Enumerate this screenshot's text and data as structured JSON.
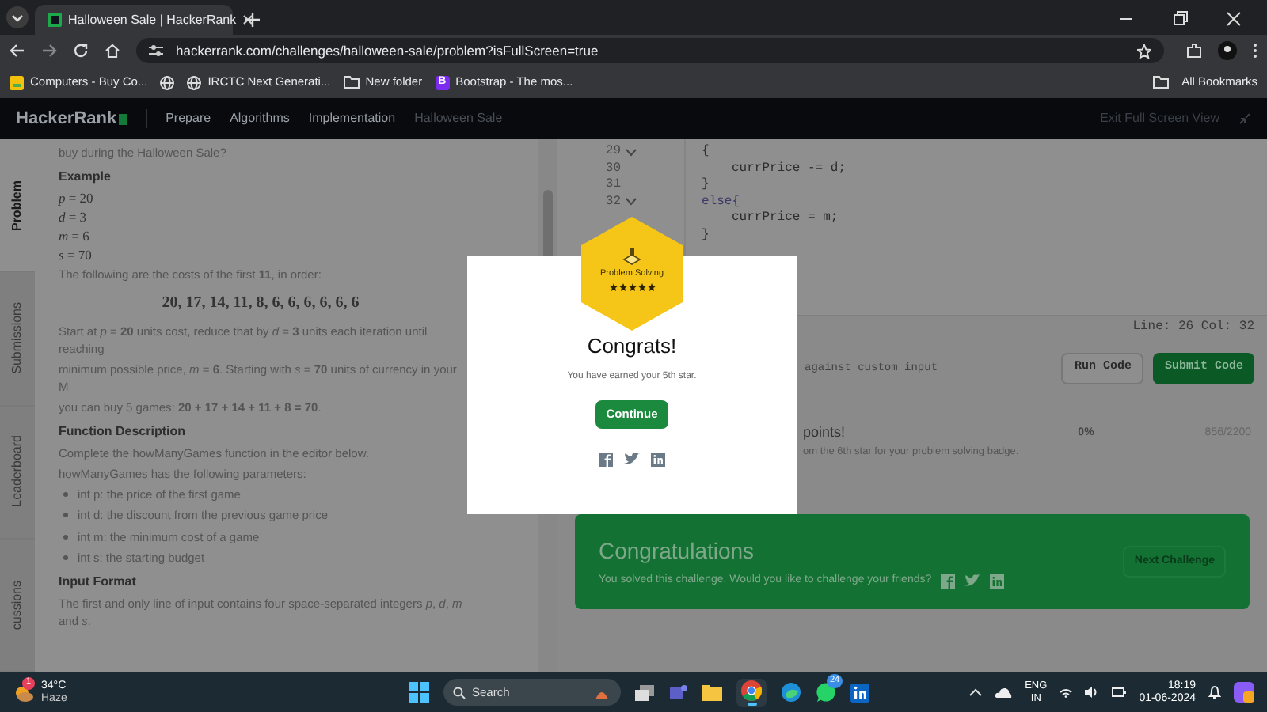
{
  "browser": {
    "tab_title": "Halloween Sale | HackerRank",
    "url": "hackerrank.com/challenges/halloween-sale/problem?isFullScreen=true",
    "bookmarks": [
      {
        "kind": "site",
        "label": "Computers - Buy Co..."
      },
      {
        "kind": "globe"
      },
      {
        "kind": "globe",
        "label": "IRCTC Next Generati..."
      },
      {
        "kind": "folder",
        "label": "New folder"
      },
      {
        "kind": "letter",
        "letter": "B",
        "label": "Bootstrap - The mos..."
      }
    ],
    "all_bookmarks": "All Bookmarks"
  },
  "nav": {
    "logo": "HackerRank",
    "items": [
      "Prepare",
      "Algorithms",
      "Implementation"
    ],
    "current": "Halloween Sale",
    "exit": "Exit Full Screen View"
  },
  "side_tabs": [
    {
      "label": "Problem",
      "selected": true
    },
    {
      "label": "Submissions",
      "selected": false
    },
    {
      "label": "Leaderboard",
      "selected": false
    },
    {
      "label": "cussions",
      "selected": false
    }
  ],
  "problem": [
    {
      "kind": "text",
      "text": "buy during the Halloween Sale?"
    },
    {
      "kind": "heading",
      "text": "Example"
    },
    {
      "kind": "math",
      "text": "*p* = 20"
    },
    {
      "kind": "math",
      "text": "*d* = 3"
    },
    {
      "kind": "math",
      "text": "*m* = 6"
    },
    {
      "kind": "math",
      "text": "*s* = 70"
    },
    {
      "kind": "text",
      "text": "The following are the costs of the first **11**, in order:"
    },
    {
      "kind": "display",
      "text": "20, 17, 14, 11, 8, 6, 6, 6, 6, 6, 6"
    },
    {
      "kind": "text",
      "text": "Start at *p* = **20** units cost, reduce that by *d* = **3** units each iteration until reaching"
    },
    {
      "kind": "text",
      "text": "minimum possible price, *m* = **6**. Starting with *s* = **70** units of currency in your M"
    },
    {
      "kind": "text",
      "text": "you can buy 5 games: **20 + 17 + 14 + 11 + 8 = 70**."
    },
    {
      "kind": "heading",
      "text": "Function Description"
    },
    {
      "kind": "text",
      "text": "Complete the howManyGames function in the editor below."
    },
    {
      "kind": "text",
      "text": "howManyGames has the following parameters:"
    },
    {
      "kind": "bullet",
      "text": "int p: the price of the first game"
    },
    {
      "kind": "bullet",
      "text": "int d: the discount from the previous game price"
    },
    {
      "kind": "bullet",
      "text": "int m: the minimum cost of a game"
    },
    {
      "kind": "bullet",
      "text": "int s: the starting budget"
    },
    {
      "kind": "heading",
      "text": "Input Format"
    },
    {
      "kind": "text",
      "text": "The first and only line of input contains four space-separated integers *p*, *d*, *m* and *s*."
    }
  ],
  "editor": {
    "lines": [
      {
        "number": "29",
        "fold": true,
        "code": "{",
        "kind": "outer"
      },
      {
        "number": "30",
        "fold": false,
        "code": "currPrice -= d;",
        "kind": "inner"
      },
      {
        "number": "31",
        "fold": false,
        "code": "}",
        "kind": "outer"
      },
      {
        "number": "32",
        "fold": true,
        "code": "else{",
        "kind": "keyword"
      },
      {
        "fold": false,
        "code": "currPrice = m;",
        "kind": "inner"
      },
      {
        "fold": false,
        "code": "}",
        "kind": "outer"
      }
    ],
    "status": "Line: 26 Col: 32"
  },
  "test": {
    "label": "against custom input",
    "run": "Run Code",
    "submit": "Submit Code"
  },
  "progress": {
    "title": "points!",
    "subtitle": "om the 6th star for your problem solving badge.",
    "percent": "0%",
    "score": "856/2200"
  },
  "banner": {
    "title": "Congratulations",
    "text": "You solved this challenge. Would you like to challenge your friends?",
    "button": "Next Challenge"
  },
  "modal": {
    "badge": {
      "title": "Problem Solving",
      "stars": 5
    },
    "title": "Congrats!",
    "message": "You have earned your 5th star.",
    "button": "Continue"
  },
  "taskbar": {
    "weather": {
      "temp": "34°C",
      "condition": "Haze",
      "badge": "1"
    },
    "search": "Search",
    "whatsapp_badge": "24",
    "lang": "ENG",
    "region": "IN",
    "time": "18:19",
    "date": "01-06-2024"
  }
}
